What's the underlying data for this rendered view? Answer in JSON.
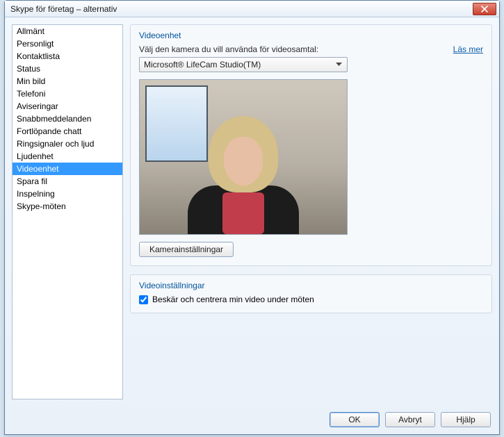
{
  "window": {
    "title": "Skype för företag – alternativ"
  },
  "sidebar": {
    "items": [
      "Allmänt",
      "Personligt",
      "Kontaktlista",
      "Status",
      "Min bild",
      "Telefoni",
      "Aviseringar",
      "Snabbmeddelanden",
      "Fortlöpande chatt",
      "Ringsignaler och ljud",
      "Ljudenhet",
      "Videoenhet",
      "Spara fil",
      "Inspelning",
      "Skype-möten"
    ],
    "selected_index": 11
  },
  "device_group": {
    "title": "Videoenhet",
    "instruction": "Välj den kamera du vill använda för videosamtal:",
    "learn_more": "Läs mer",
    "dropdown_value": "Microsoft® LifeCam Studio(TM)",
    "camera_settings_button": "Kamerainställningar"
  },
  "settings_group": {
    "title": "Videoinställningar",
    "crop_checkbox_label": "Beskär och centrera min video under möten",
    "crop_checked": true
  },
  "footer": {
    "ok": "OK",
    "cancel": "Avbryt",
    "help": "Hjälp"
  }
}
